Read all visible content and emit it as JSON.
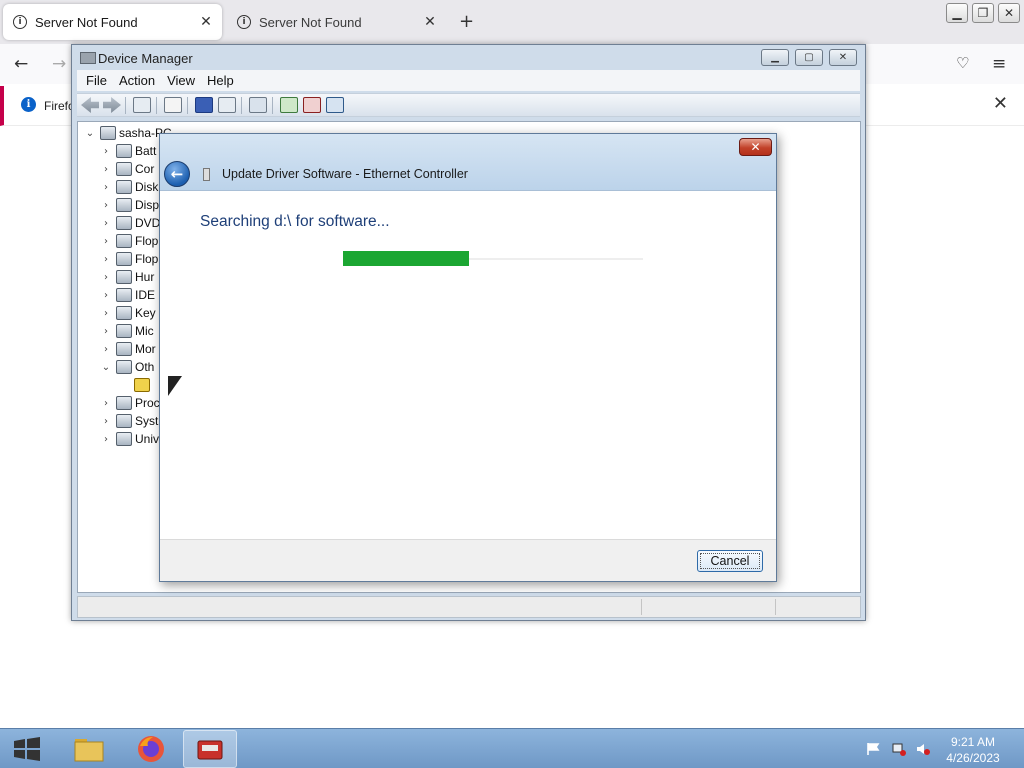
{
  "firefox": {
    "tabs": [
      {
        "title": "Server Not Found",
        "active": true
      },
      {
        "title": "Server Not Found",
        "active": false
      }
    ],
    "notification_text": "Firefo"
  },
  "device_manager": {
    "title": "Device Manager",
    "menu": [
      "File",
      "Action",
      "View",
      "Help"
    ],
    "tree": {
      "root": "sasha-PC",
      "items": [
        {
          "label": "Batt",
          "expanded": false
        },
        {
          "label": "Cor",
          "expanded": false
        },
        {
          "label": "Disk",
          "expanded": false
        },
        {
          "label": "Disp",
          "expanded": false
        },
        {
          "label": "DVD",
          "expanded": false
        },
        {
          "label": "Flop",
          "expanded": false
        },
        {
          "label": "Flop",
          "expanded": false
        },
        {
          "label": "Hur",
          "expanded": false
        },
        {
          "label": "IDE",
          "expanded": false
        },
        {
          "label": "Key",
          "expanded": false
        },
        {
          "label": "Mic",
          "expanded": false
        },
        {
          "label": "Mor",
          "expanded": false
        },
        {
          "label": "Oth",
          "expanded": true
        },
        {
          "label": "",
          "expanded": false,
          "child": true,
          "warning": true
        },
        {
          "label": "Proc",
          "expanded": false
        },
        {
          "label": "Syst",
          "expanded": false
        },
        {
          "label": "Univ",
          "expanded": false
        }
      ]
    }
  },
  "update_dialog": {
    "title": "Update Driver Software - Ethernet Controller",
    "heading": "Searching d:\\ for software...",
    "progress": 0.42,
    "cancel_label": "Cancel"
  },
  "taskbar": {
    "clock_time": "9:21 AM",
    "clock_date": "4/26/2023"
  },
  "colors": {
    "progress_fill": "#1ba632",
    "heading_text": "#1e3f78",
    "taskbar": "#7fa7d3"
  }
}
